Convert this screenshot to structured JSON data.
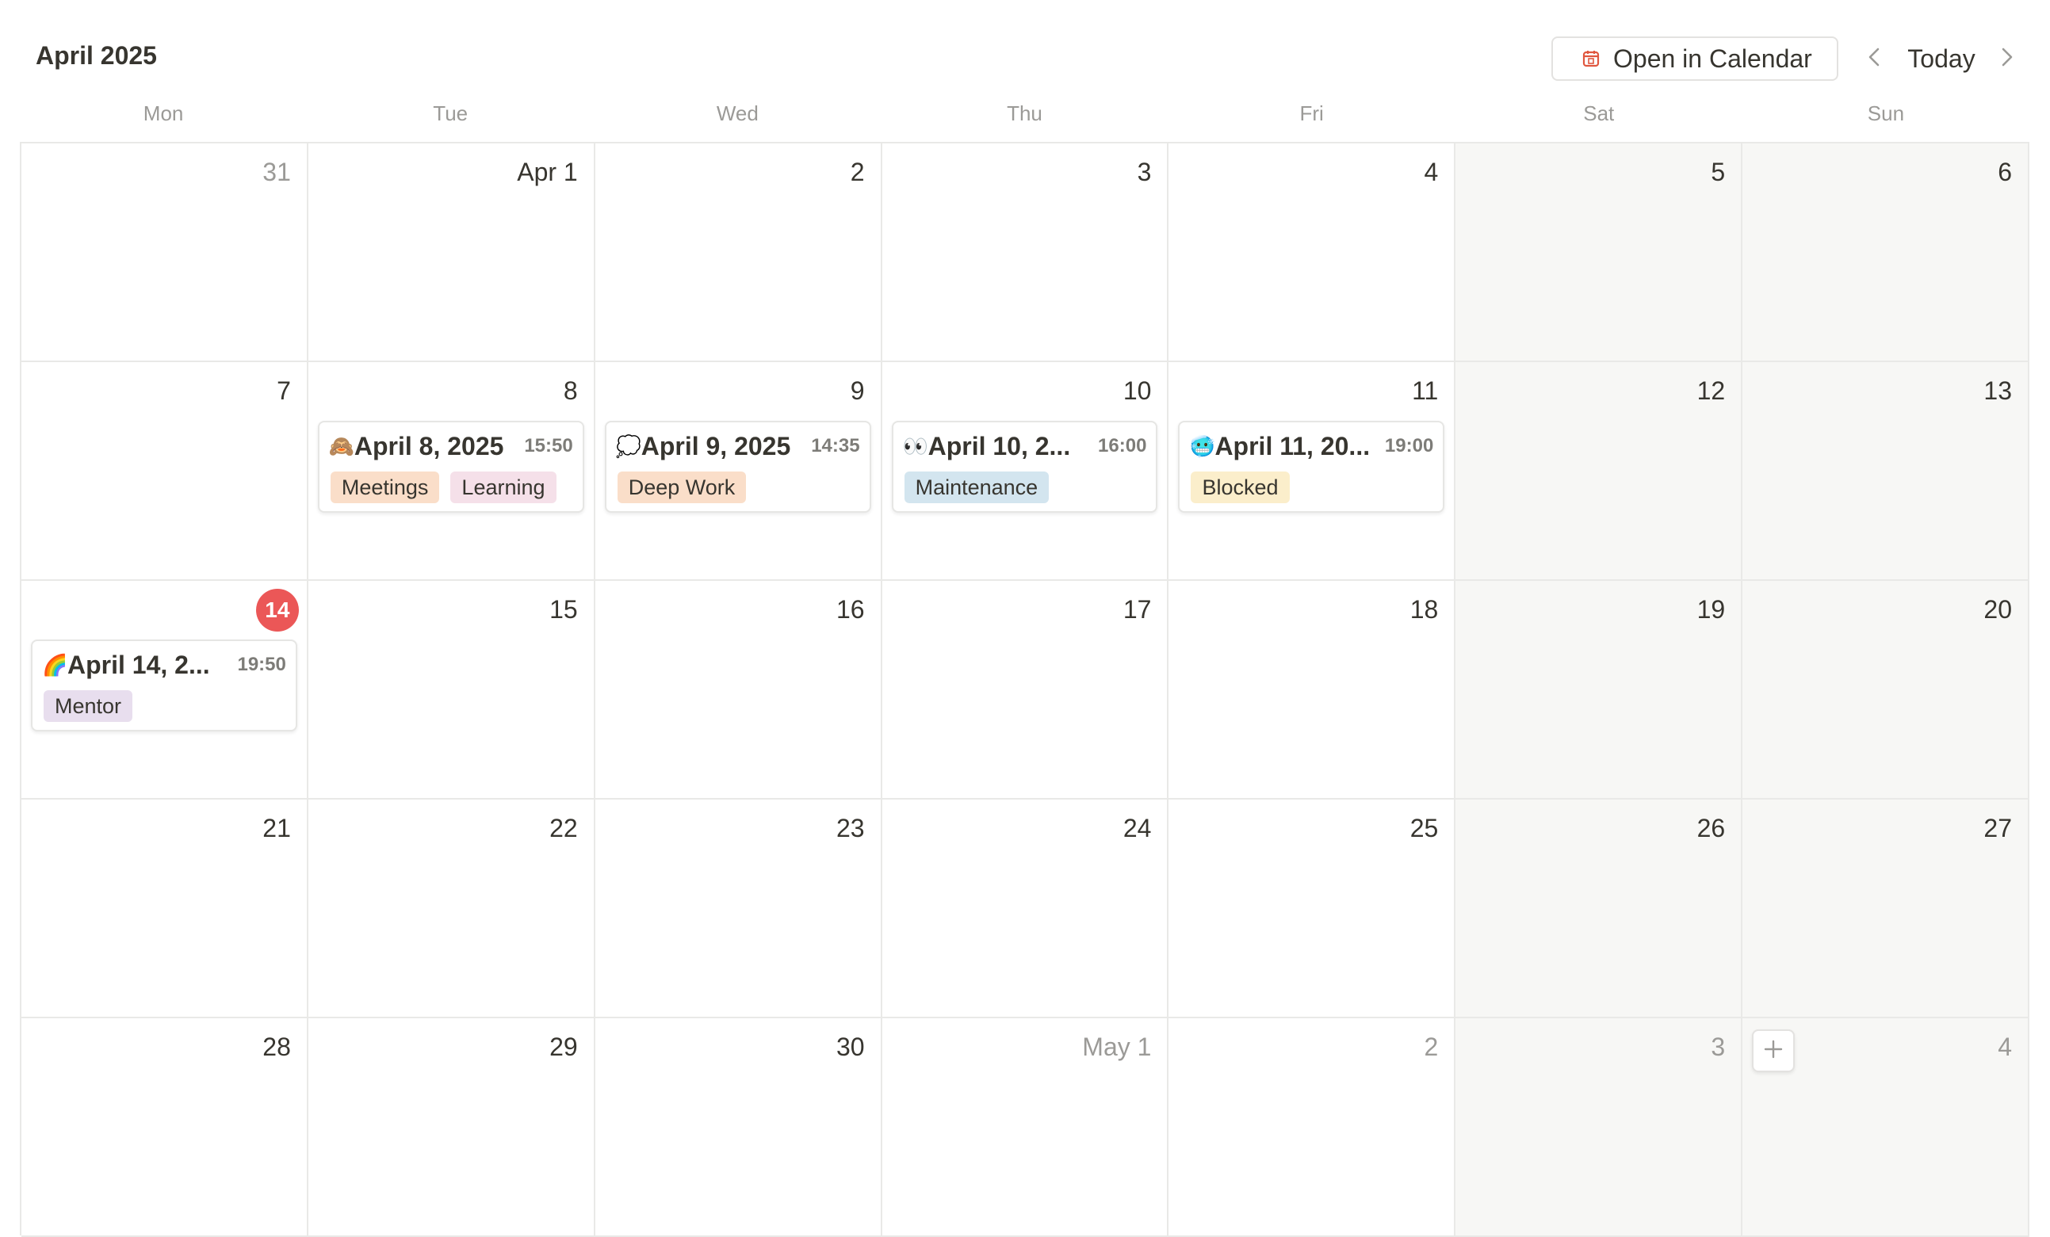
{
  "header": {
    "title": "April 2025",
    "open_button_label": "Open in Calendar",
    "today_label": "Today",
    "prev_icon": "chevron-left-icon",
    "next_icon": "chevron-right-icon",
    "calendar_icon": "calendar-icon"
  },
  "weekdays": [
    "Mon",
    "Tue",
    "Wed",
    "Thu",
    "Fri",
    "Sat",
    "Sun"
  ],
  "colors": {
    "today_badge": "#eb5757",
    "weekend_bg": "#f7f7f5",
    "tag_meetings": "#fadec9",
    "tag_learning": "#f5e0e9",
    "tag_deep_work": "#fadec9",
    "tag_maintenance": "#d3e5ef",
    "tag_blocked": "#fbeecb",
    "tag_mentor": "#e8deee"
  },
  "weeks": [
    {
      "days": [
        {
          "label": "31",
          "muted": true
        },
        {
          "label": "Apr 1"
        },
        {
          "label": "2"
        },
        {
          "label": "3"
        },
        {
          "label": "4"
        },
        {
          "label": "5",
          "weekend": true
        },
        {
          "label": "6",
          "weekend": true
        }
      ]
    },
    {
      "days": [
        {
          "label": "7"
        },
        {
          "label": "8",
          "event": {
            "emoji": "🙈",
            "title": "April 8, 2025",
            "time": "15:50",
            "tags": [
              {
                "label": "Meetings",
                "color": "#fadec9"
              },
              {
                "label": "Learning",
                "color": "#f5e0e9"
              }
            ]
          }
        },
        {
          "label": "9",
          "event": {
            "emoji": "💭",
            "title": "April 9, 2025",
            "time": "14:35",
            "tags": [
              {
                "label": "Deep Work",
                "color": "#fadec9"
              }
            ]
          }
        },
        {
          "label": "10",
          "event": {
            "emoji": "👀",
            "title": "April 10, 2...",
            "time": "16:00",
            "tags": [
              {
                "label": "Maintenance",
                "color": "#d3e5ef"
              }
            ]
          }
        },
        {
          "label": "11",
          "event": {
            "emoji": "🥶",
            "title": "April 11, 20...",
            "time": "19:00",
            "tags": [
              {
                "label": "Blocked",
                "color": "#fbeecb"
              }
            ]
          }
        },
        {
          "label": "12",
          "weekend": true
        },
        {
          "label": "13",
          "weekend": true
        }
      ]
    },
    {
      "days": [
        {
          "label": "14",
          "today": true,
          "event": {
            "emoji": "🌈",
            "title": "April 14, 2...",
            "time": "19:50",
            "tags": [
              {
                "label": "Mentor",
                "color": "#e8deee"
              }
            ]
          }
        },
        {
          "label": "15"
        },
        {
          "label": "16"
        },
        {
          "label": "17"
        },
        {
          "label": "18"
        },
        {
          "label": "19",
          "weekend": true
        },
        {
          "label": "20",
          "weekend": true
        }
      ]
    },
    {
      "days": [
        {
          "label": "21"
        },
        {
          "label": "22"
        },
        {
          "label": "23"
        },
        {
          "label": "24"
        },
        {
          "label": "25"
        },
        {
          "label": "26",
          "weekend": true
        },
        {
          "label": "27",
          "weekend": true
        }
      ]
    },
    {
      "days": [
        {
          "label": "28"
        },
        {
          "label": "29"
        },
        {
          "label": "30"
        },
        {
          "label": "May 1",
          "muted": true
        },
        {
          "label": "2",
          "muted": true
        },
        {
          "label": "3",
          "muted": true,
          "weekend": true
        },
        {
          "label": "4",
          "muted": true,
          "weekend": true,
          "add_button": true
        }
      ]
    }
  ]
}
